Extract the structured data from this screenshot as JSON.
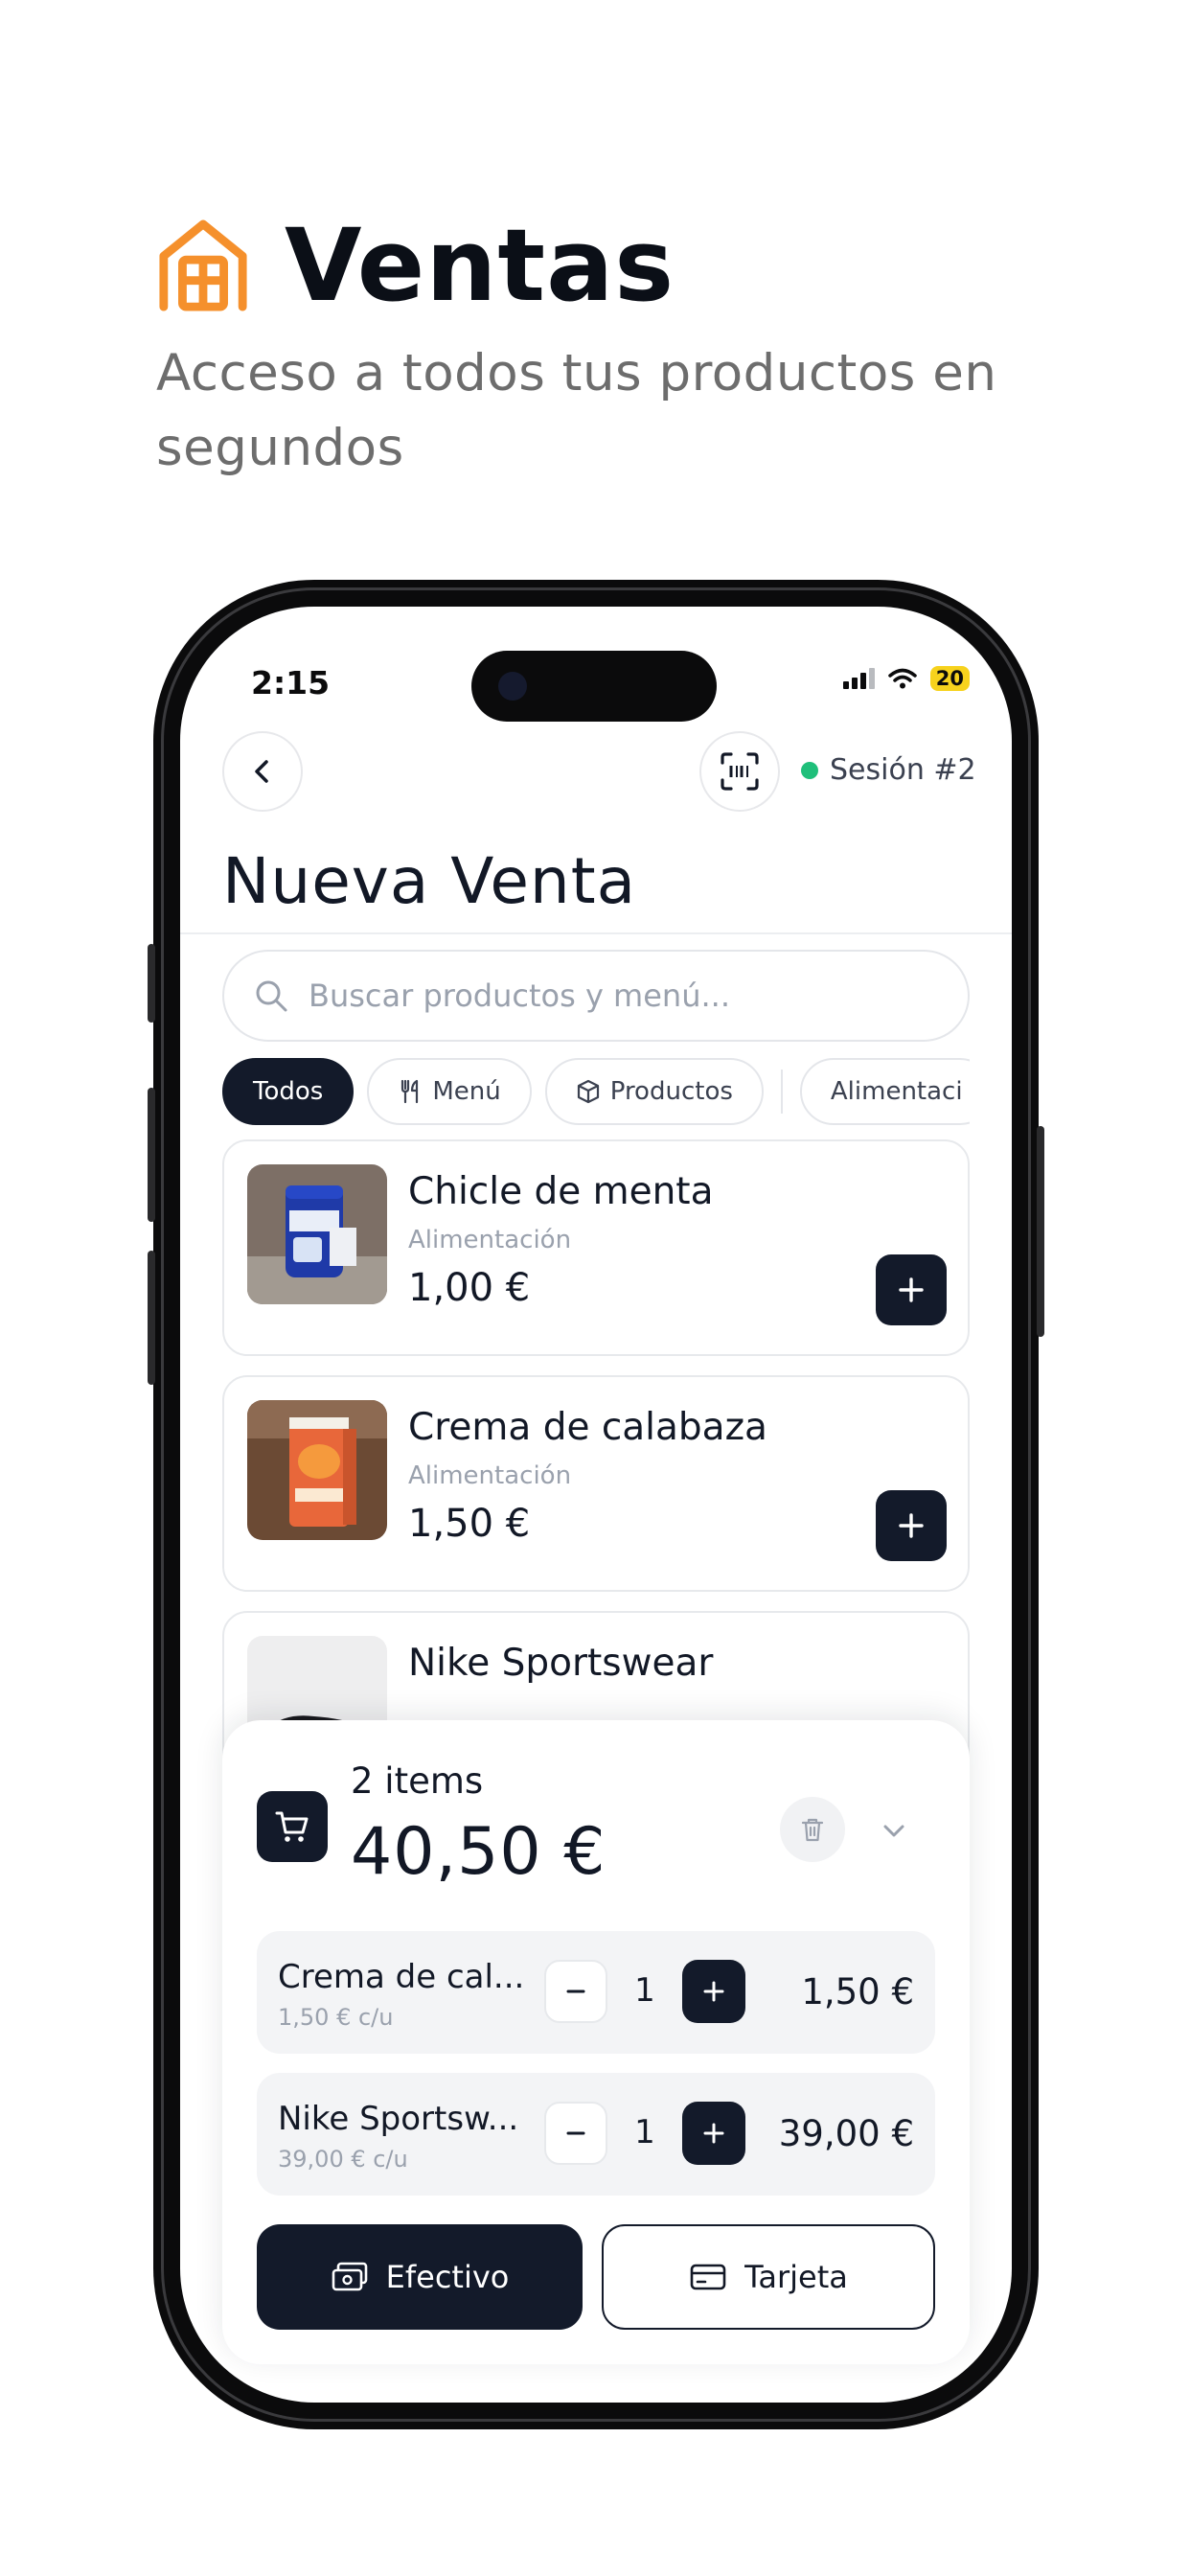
{
  "hero": {
    "title": "Ventas",
    "subtitle": "Acceso a todos tus productos en segundos",
    "icon": "store-icon",
    "accent_color": "#f5902c"
  },
  "status_bar": {
    "time": "2:15",
    "battery": "20"
  },
  "header": {
    "back_icon": "chevron-left-icon",
    "scan_icon": "barcode-scan-icon",
    "session_label": "Sesión #2",
    "session_status_color": "#1fbf7a",
    "title": "Nueva Venta"
  },
  "search": {
    "placeholder": "Buscar productos y menú..."
  },
  "filters": [
    {
      "label": "Todos",
      "icon": "",
      "active": true
    },
    {
      "label": "Menú",
      "icon": "fork-knife-icon",
      "active": false
    },
    {
      "label": "Productos",
      "icon": "box-icon",
      "active": false
    },
    {
      "label": "Alimentaci",
      "icon": "",
      "active": false
    }
  ],
  "products": [
    {
      "name": "Chicle de menta",
      "category": "Alimentación",
      "price": "1,00 €"
    },
    {
      "name": "Crema de calabaza",
      "category": "Alimentación",
      "price": "1,50 €"
    },
    {
      "name": "Nike Sportswear",
      "category": "",
      "price": ""
    }
  ],
  "cart": {
    "count": "2 items",
    "total": "40,50 €",
    "lines": [
      {
        "name": "Crema de cal...",
        "unit": "1,50 € c/u",
        "qty": "1",
        "total": "1,50 €"
      },
      {
        "name": "Nike Sportsw...",
        "unit": "39,00 € c/u",
        "qty": "1",
        "total": "39,00 €"
      }
    ],
    "pay_cash": "Efectivo",
    "pay_card": "Tarjeta"
  },
  "colors": {
    "primary_dark": "#131a2a",
    "muted_text": "#9aa1ad"
  }
}
